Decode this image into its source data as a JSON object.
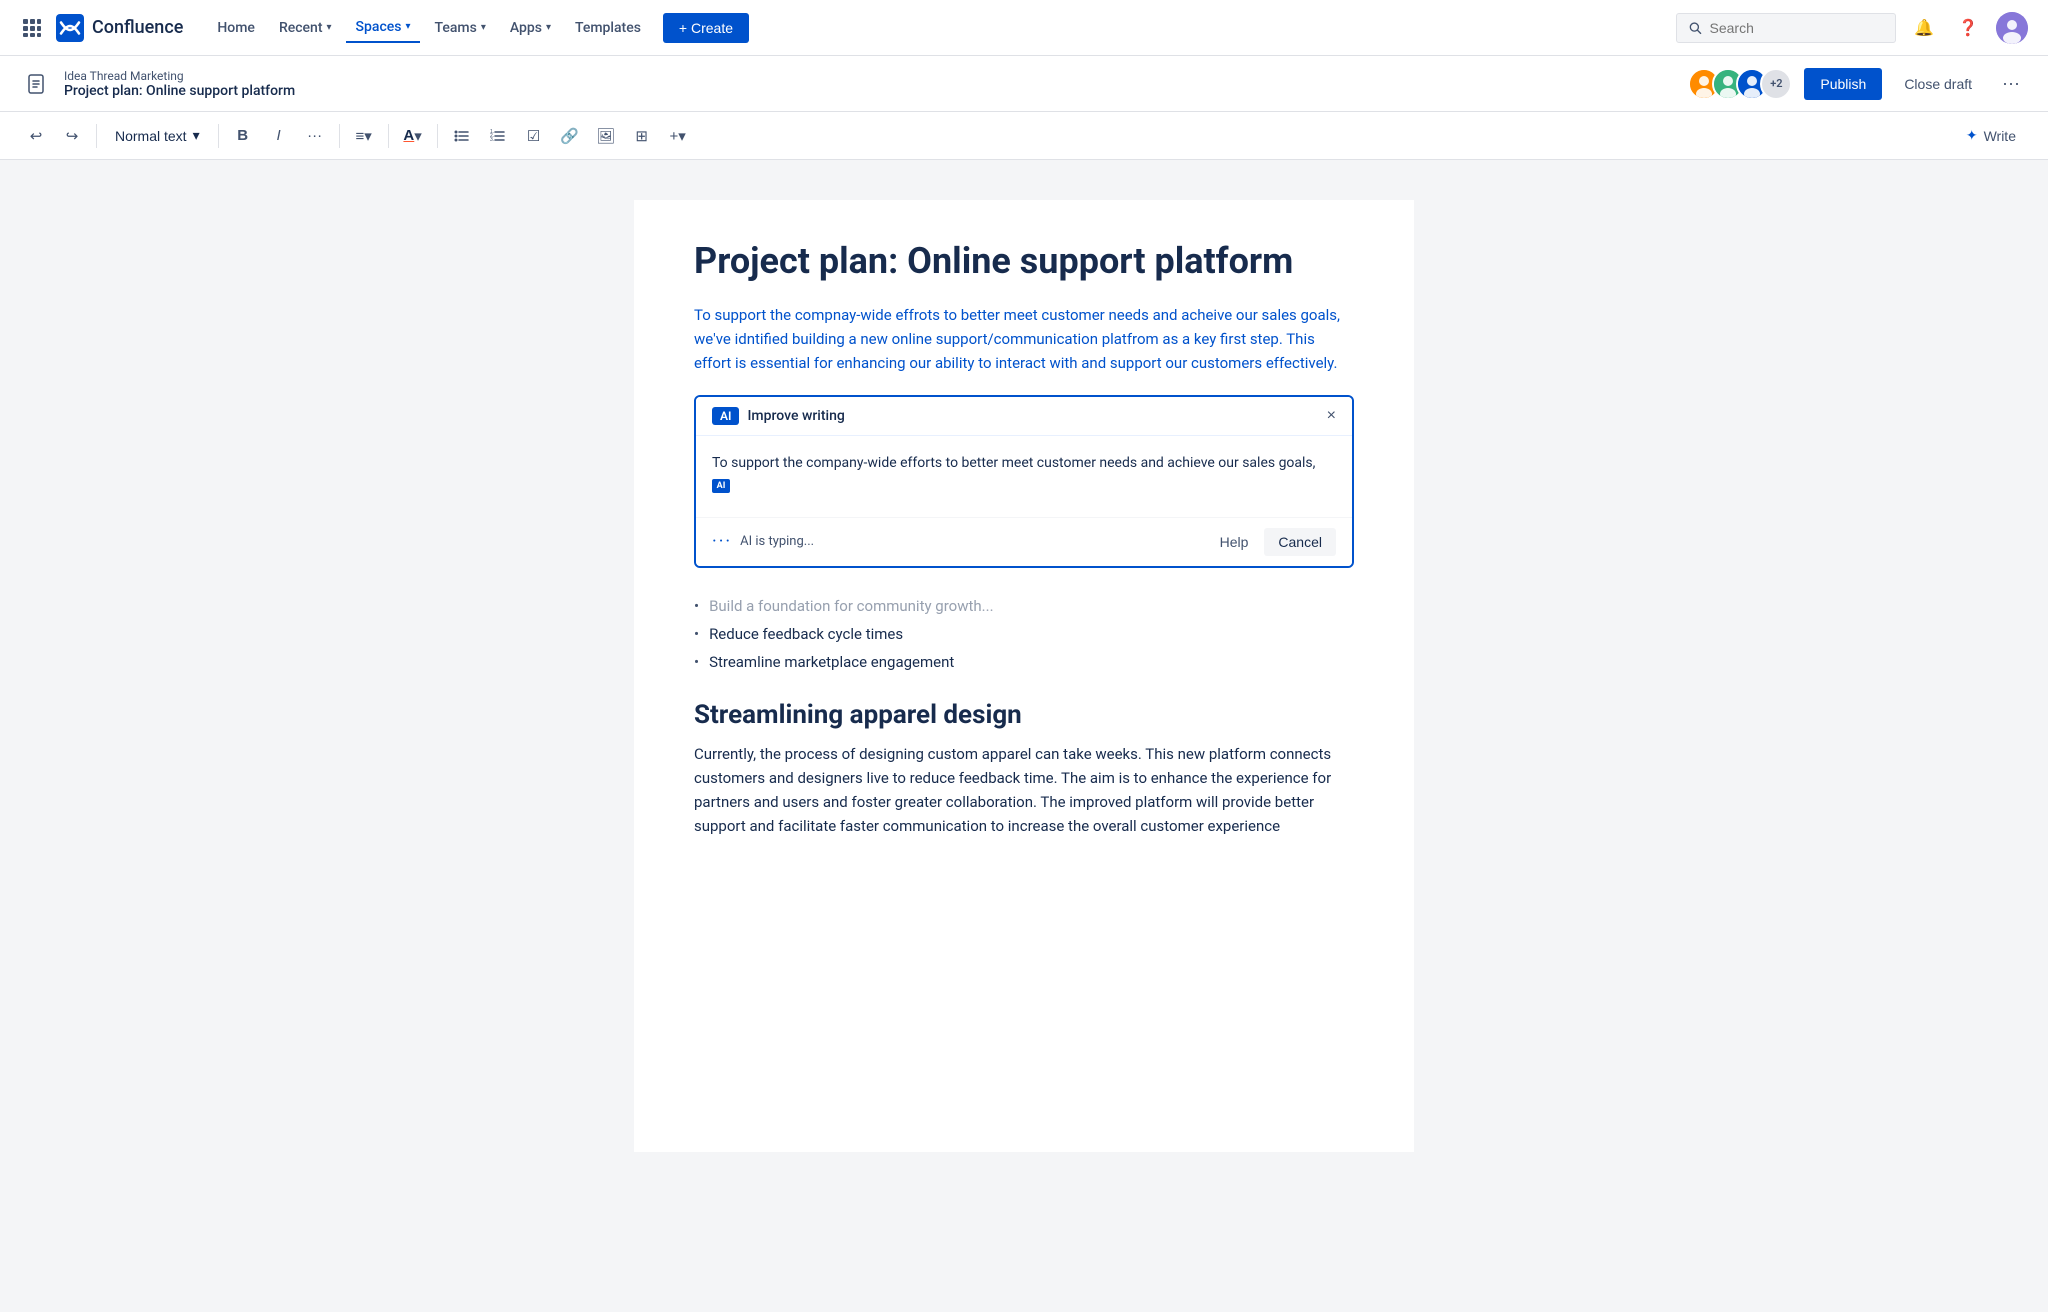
{
  "app": {
    "name": "Confluence",
    "logo_text": "Confluence"
  },
  "navbar": {
    "home": "Home",
    "recent": "Recent",
    "spaces": "Spaces",
    "teams": "Teams",
    "apps": "Apps",
    "templates": "Templates",
    "create": "+ Create",
    "search_placeholder": "Search"
  },
  "doc_header": {
    "breadcrumb_parent": "Idea Thread Marketing",
    "breadcrumb_title": "Project plan: Online support platform",
    "avatar_count": "+2",
    "publish_label": "Publish",
    "close_draft_label": "Close draft"
  },
  "toolbar": {
    "text_style": "Normal text",
    "write_label": "Write"
  },
  "editor": {
    "title": "Project plan: Online support platform",
    "intro": "To support the compnay-wide effrots to better meet customer needs and acheive our sales goals, we've idntified building a new online support/communication platfrom as a key first step. This effort is essential for enhancing our ability to interact with and support our customers effectively.",
    "ai_box": {
      "tag": "AI",
      "tag_label": "Improve writing",
      "close_label": "×",
      "typing_text": "To support the company-wide efforts to better meet customer needs and achieve our sales goals,",
      "ai_cursor_label": "AI",
      "dots": "···",
      "status": "AI is typing...",
      "help_label": "Help",
      "cancel_label": "Cancel"
    },
    "bullets": [
      "Build a foundation for community growth...",
      "Reduce feedback cycle times",
      "Streamline marketplace engagement"
    ],
    "section2_heading": "Streamlining apparel design",
    "section2_body": "Currently, the process of designing custom apparel can take weeks. This new platform connects customers and designers live to reduce feedback time. The aim is to enhance the experience for partners and users and foster greater collaboration. The improved platform will provide better support and facilitate faster communication to increase the overall customer experience"
  }
}
